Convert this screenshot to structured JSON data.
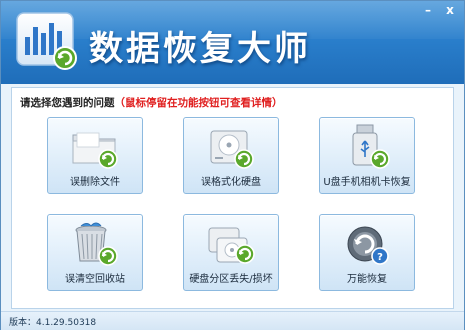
{
  "window": {
    "title": "数据恢复大师",
    "controls": {
      "minimize": "–",
      "close": "x"
    }
  },
  "prompt": {
    "label": "请选择您遇到的问题",
    "hint": "（鼠标停留在功能按钮可查看详情）"
  },
  "tiles": [
    {
      "label": "误删除文件",
      "icon": "folder-recover-icon"
    },
    {
      "label": "误格式化硬盘",
      "icon": "hard-disk-recover-icon"
    },
    {
      "label": "U盘手机相机卡恢复",
      "icon": "usb-drive-recover-icon"
    },
    {
      "label": "误清空回收站",
      "icon": "recycle-bin-recover-icon"
    },
    {
      "label": "硬盘分区丢失/损坏",
      "icon": "partition-recover-icon"
    },
    {
      "label": "万能恢复",
      "icon": "universal-recover-icon"
    }
  ],
  "footer": {
    "version": "版本：4.1.29.50318"
  },
  "colors": {
    "header": "#2a7fcc",
    "accent_green": "#5aa82b",
    "hint_red": "#e02020"
  }
}
